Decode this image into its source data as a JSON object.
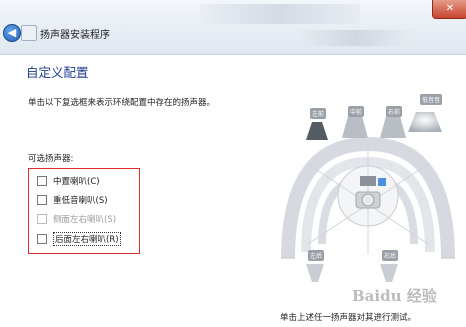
{
  "window": {
    "title": "扬声器安装程序"
  },
  "page": {
    "heading": "自定义配置",
    "instructions": "单击以下复选框来表示环绕配置中存在的扬声器。",
    "group_label": "可选扬声器:",
    "speakers": [
      {
        "label": "中置喇叭(C)",
        "checked": false,
        "enabled": true
      },
      {
        "label": "重低音喇叭(S)",
        "checked": false,
        "enabled": true
      },
      {
        "label": "侧面左右喇叭(S)",
        "checked": false,
        "enabled": false
      },
      {
        "label": "后面左右喇叭(R)",
        "checked": false,
        "enabled": true,
        "focused": true
      }
    ],
    "footer": "单击上述任一扬声器对其进行测试。"
  },
  "diagram": {
    "labels": {
      "front_left": "左前",
      "center": "中前",
      "front_right": "右前",
      "subwoofer": "低音音",
      "rear_left": "左后",
      "rear_right": "右后"
    }
  },
  "watermark": "Baidu 经验"
}
